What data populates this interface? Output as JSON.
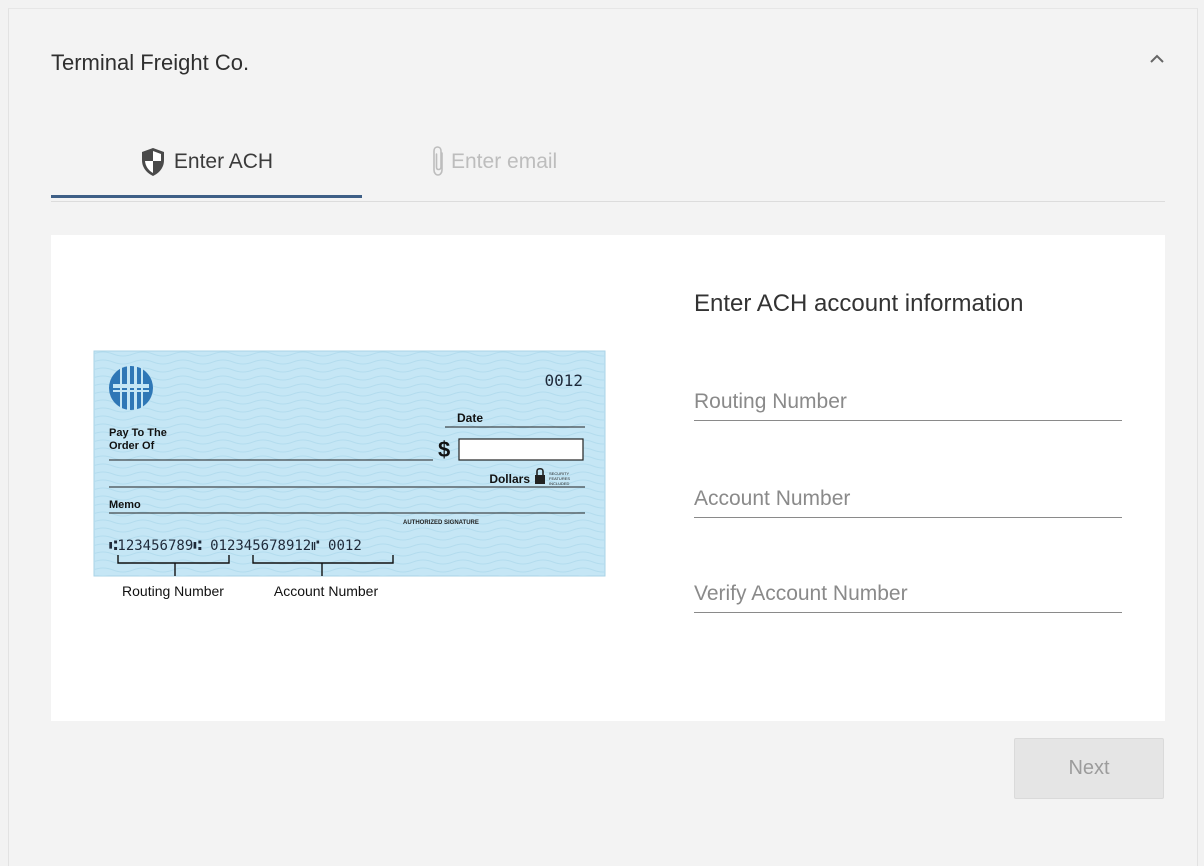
{
  "header": {
    "title": "Terminal Freight Co.",
    "collapse_icon": "chevron-up-icon"
  },
  "tabs": [
    {
      "label": "Enter ACH",
      "icon": "shield-icon",
      "active": true
    },
    {
      "label": "Enter email",
      "icon": "paperclip-icon",
      "active": false
    }
  ],
  "form": {
    "title": "Enter ACH account information",
    "fields": [
      {
        "placeholder": "Routing Number",
        "value": ""
      },
      {
        "placeholder": "Account Number",
        "value": ""
      },
      {
        "placeholder": "Verify Account Number",
        "value": ""
      }
    ]
  },
  "check": {
    "check_number": "0012",
    "date_label": "Date",
    "pay_to_line1": "Pay To The",
    "pay_to_line2": "Order Of",
    "dollar_sign": "$",
    "dollars_label": "Dollars",
    "security_line1": "SECURITY",
    "security_line2": "FEATURES",
    "security_line3": "INCLUDED",
    "memo_label": "Memo",
    "signature_label": "AUTHORIZED SIGNATURE",
    "micr_line": "⑆123456789⑆ 012345678912⑈ 0012",
    "routing_caption": "Routing Number",
    "account_caption": "Account Number"
  },
  "actions": {
    "next_label": "Next"
  },
  "colors": {
    "accent": "#3e5f86",
    "check_bg": "#c5e6f5",
    "disabled_bg": "#e5e5e5"
  }
}
